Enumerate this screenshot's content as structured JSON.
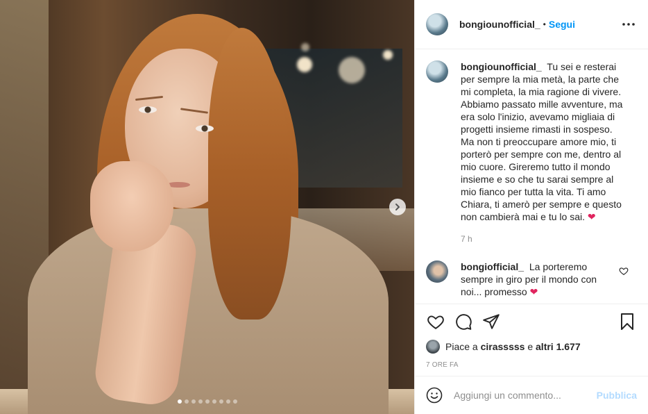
{
  "post": {
    "carousel": {
      "total_slides": 9,
      "active_slide": 1,
      "next_icon": "chevron-right-icon"
    }
  },
  "header": {
    "username": "bongiounofficial_",
    "separator": "•",
    "follow_label": "Segui",
    "more_icon": "more-horizontal-icon"
  },
  "caption": {
    "username": "bongiounofficial_",
    "text": "Tu sei e resterai per sempre la mia metà, la parte che mi completa, la mia ragione di vivere. Abbiamo passato mille avventure, ma era solo l'inizio, avevamo migliaia di progetti insieme rimasti in sospeso. Ma non ti preoccupare amore mio, ti porterò per sempre con me, dentro al mio cuore. Gireremo tutto il mondo insieme e so che tu sarai sempre al mio fianco per tutta la vita. Ti amo Chiara, ti amerò per sempre e questo non cambierà mai e tu lo sai.",
    "emoji": "❤",
    "time": "7 h"
  },
  "reply": {
    "username": "bongiofficial_",
    "text": "La porteremo sempre in giro per il mondo con noi... promesso",
    "emoji": "❤",
    "like_icon": "heart-outline-icon"
  },
  "actions": {
    "like_icon": "heart-outline-icon",
    "comment_icon": "comment-icon",
    "share_icon": "paper-plane-icon",
    "save_icon": "bookmark-icon"
  },
  "likes": {
    "prefix": "Piace a",
    "user": "cirasssss",
    "middle": "e",
    "others": "altri 1.677"
  },
  "post_time": "7 ORE FA",
  "add_comment": {
    "emoji_icon": "smiley-icon",
    "placeholder": "Aggiungi un commento...",
    "publish_label": "Pubblica"
  },
  "colors": {
    "accent": "#0095f6",
    "publish_disabled": "#b3dbff",
    "heart_red": "#e0245e",
    "muted": "#8e8e8e"
  }
}
